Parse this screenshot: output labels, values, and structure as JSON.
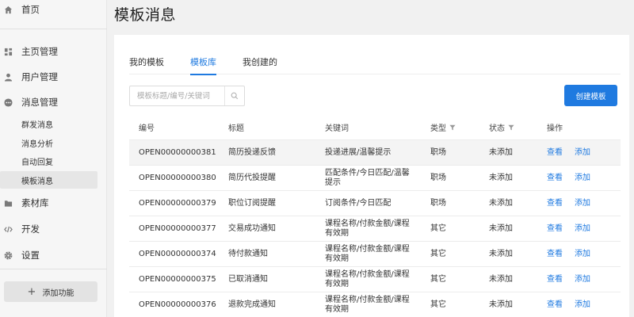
{
  "sidebar": {
    "items": [
      {
        "label": "首页",
        "icon": "home-icon"
      },
      {
        "label": "主页管理",
        "icon": "grid-icon"
      },
      {
        "label": "用户管理",
        "icon": "user-icon"
      },
      {
        "label": "消息管理",
        "icon": "message-icon"
      },
      {
        "label": "素材库",
        "icon": "folder-icon"
      },
      {
        "label": "开发",
        "icon": "code-icon"
      },
      {
        "label": "设置",
        "icon": "gear-icon"
      }
    ],
    "sub_items": [
      {
        "label": "群发消息"
      },
      {
        "label": "消息分析"
      },
      {
        "label": "自动回复"
      },
      {
        "label": "模板消息",
        "active": true
      }
    ],
    "add_button": "添加功能"
  },
  "page": {
    "title": "模板消息"
  },
  "tabs": [
    {
      "label": "我的模板",
      "active": false
    },
    {
      "label": "模板库",
      "active": true
    },
    {
      "label": "我创建的",
      "active": false
    }
  ],
  "search": {
    "placeholder": "模板标题/编号/关键词",
    "value": ""
  },
  "create_button": "创建模板",
  "table": {
    "headers": {
      "id": "编号",
      "title": "标题",
      "keywords": "关键词",
      "type": "类型",
      "status": "状态",
      "actions": "操作"
    },
    "view_label": "查看",
    "add_label": "添加",
    "rows": [
      {
        "id": "OPEN00000000381",
        "title": "简历投递反馈",
        "keywords": "投递进展/温馨提示",
        "type": "职场",
        "status": "未添加"
      },
      {
        "id": "OPEN00000000380",
        "title": "简历代投提醒",
        "keywords": "匹配条件/今日匹配/温馨提示",
        "type": "职场",
        "status": "未添加"
      },
      {
        "id": "OPEN00000000379",
        "title": "职位订阅提醒",
        "keywords": "订阅条件/今日匹配",
        "type": "职场",
        "status": "未添加"
      },
      {
        "id": "OPEN00000000377",
        "title": "交易成功通知",
        "keywords": "课程名称/付款金额/课程有效期",
        "type": "其它",
        "status": "未添加"
      },
      {
        "id": "OPEN00000000374",
        "title": "待付款通知",
        "keywords": "课程名称/付款金额/课程有效期",
        "type": "其它",
        "status": "未添加"
      },
      {
        "id": "OPEN00000000375",
        "title": "已取消通知",
        "keywords": "课程名称/付款金额/课程有效期",
        "type": "其它",
        "status": "未添加"
      },
      {
        "id": "OPEN00000000376",
        "title": "退款完成通知",
        "keywords": "课程名称/付款金额/课程有效期",
        "type": "其它",
        "status": "未添加"
      }
    ]
  },
  "colors": {
    "accent": "#1f7ae0",
    "sidebar_bg": "#f6f6f6",
    "highlight_row": "#f4f4f4"
  }
}
